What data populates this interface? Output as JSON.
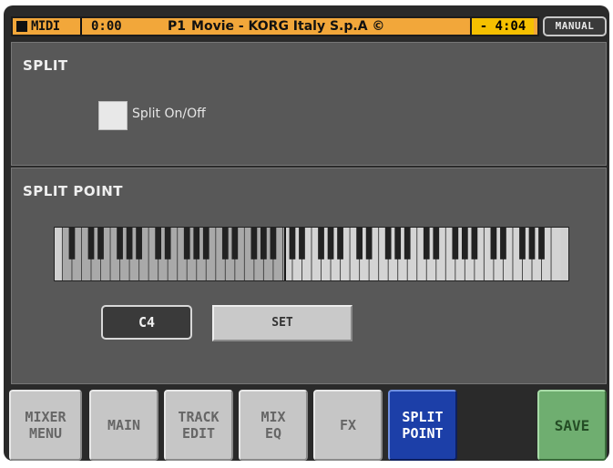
{
  "status_bar": {
    "midi_label": "MIDI",
    "time": "0:00",
    "program": "P1",
    "song_title": "Movie - KORG Italy S.p.A ©",
    "remaining": "- 4:04",
    "mode_button": "MANUAL"
  },
  "split_section": {
    "title": "SPLIT",
    "checkbox_label": "Split On/Off",
    "checked": false
  },
  "split_point_section": {
    "title": "SPLIT POINT",
    "note_value": "C4",
    "set_label": "SET"
  },
  "tabs": [
    {
      "label": "MIXER\nMENU",
      "active": false
    },
    {
      "label": "MAIN",
      "active": false
    },
    {
      "label": "TRACK\nEDIT",
      "active": false
    },
    {
      "label": "MIX\nEQ",
      "active": false
    },
    {
      "label": "FX",
      "active": false
    },
    {
      "label": "SPLIT\nPOINT",
      "active": true
    }
  ],
  "save_label": "SAVE",
  "colors": {
    "status_bar": "#f2a73a",
    "remaining_box": "#f5c000",
    "panel": "#585858",
    "active_tab": "#1c3fa8",
    "save": "#6fae70"
  }
}
